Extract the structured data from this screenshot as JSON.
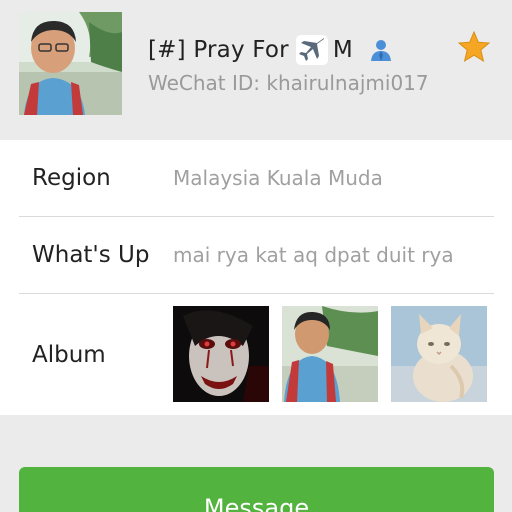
{
  "profile": {
    "name_prefix": "[#] Pray For",
    "name_suffix": "M",
    "name_emoji_icon": "airplane-icon",
    "contact_icon": "person-icon",
    "wechat_id": "WeChat ID: khairulnajmi017",
    "star_icon": "star-icon",
    "accent_star_color": "#f5a623",
    "accent_person_color": "#4a8fd8"
  },
  "details": {
    "region": {
      "label": "Region",
      "value": "Malaysia  Kuala Muda"
    },
    "whats_up": {
      "label": "What's Up",
      "value": "mai rya kat aq dpat duit rya"
    },
    "album": {
      "label": "Album",
      "photos": [
        "zombie-face-photo",
        "boy-outdoors-photo",
        "kitten-photo"
      ]
    }
  },
  "actions": {
    "message_label": "Message",
    "message_color": "#53b33f"
  }
}
